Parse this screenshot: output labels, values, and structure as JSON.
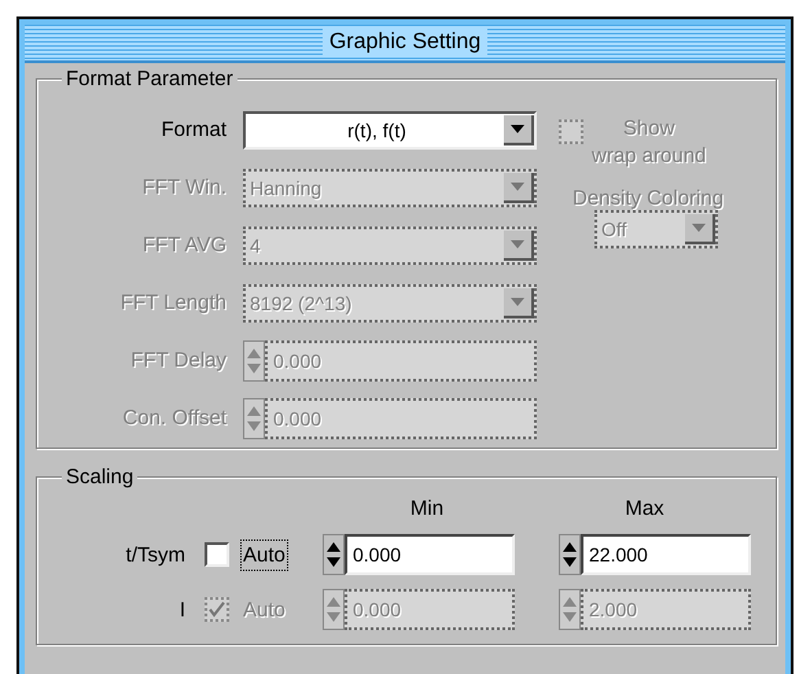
{
  "window": {
    "title": "Graphic Setting"
  },
  "format_parameter": {
    "title": "Format Parameter",
    "rows": [
      {
        "label": "Format",
        "kind": "combo",
        "value": "r(t), f(t)",
        "disabled": false
      },
      {
        "label": "FFT Win.",
        "kind": "combo",
        "value": "Hanning",
        "disabled": true
      },
      {
        "label": "FFT AVG",
        "kind": "combo",
        "value": "4",
        "disabled": true
      },
      {
        "label": "FFT Length",
        "kind": "combo",
        "value": "8192 (2^13)",
        "disabled": true
      },
      {
        "label": "FFT Delay",
        "kind": "spin",
        "value": "0.000",
        "disabled": true
      },
      {
        "label": "Con. Offset",
        "kind": "spin",
        "value": "0.000",
        "disabled": true
      }
    ],
    "wrap_around": {
      "label_lines": [
        "Show",
        "wrap around"
      ],
      "checked": false,
      "disabled": true
    },
    "density_coloring": {
      "label": "Density Coloring",
      "value": "Off",
      "disabled": true
    }
  },
  "scaling": {
    "title": "Scaling",
    "columns": [
      "Min",
      "Max"
    ],
    "rows": [
      {
        "label": "t/Tsym",
        "auto": {
          "label": "Auto",
          "checked": false,
          "focused": true
        },
        "min": "0.000",
        "max": "22.000",
        "disabled": false
      },
      {
        "label": "I",
        "auto": {
          "label": "Auto",
          "checked": true,
          "focused": false
        },
        "min": "0.000",
        "max": "2.000",
        "disabled": true
      }
    ]
  }
}
